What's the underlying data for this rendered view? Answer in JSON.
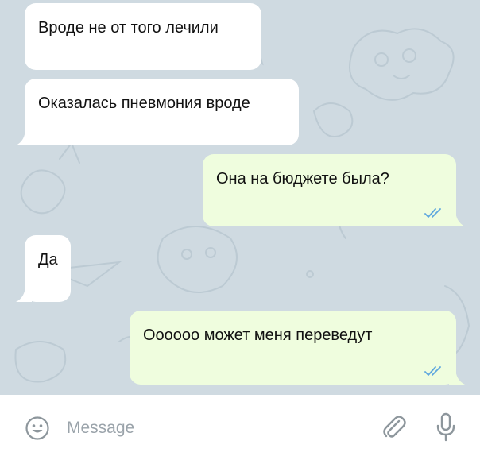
{
  "messages": [
    {
      "side": "incoming",
      "text": "Вроде не от того лечили"
    },
    {
      "side": "incoming",
      "text": "Оказалась пневмония вроде"
    },
    {
      "side": "outgoing",
      "text": "Она на бюджете была?",
      "status": "read"
    },
    {
      "side": "incoming",
      "text": "Да"
    },
    {
      "side": "outgoing",
      "text": "Оооооо может меня переведут",
      "status": "read"
    }
  ],
  "composer": {
    "placeholder": "Message",
    "left_icon": "emoji-icon",
    "attach_icon": "paperclip-icon",
    "mic_icon": "microphone-icon"
  },
  "colors": {
    "chat_background": "#cfdae1",
    "incoming_bubble": "#ffffff",
    "outgoing_bubble": "#effdde",
    "read_ticks": "#5ea7de",
    "icon_gray": "#8d969c"
  }
}
